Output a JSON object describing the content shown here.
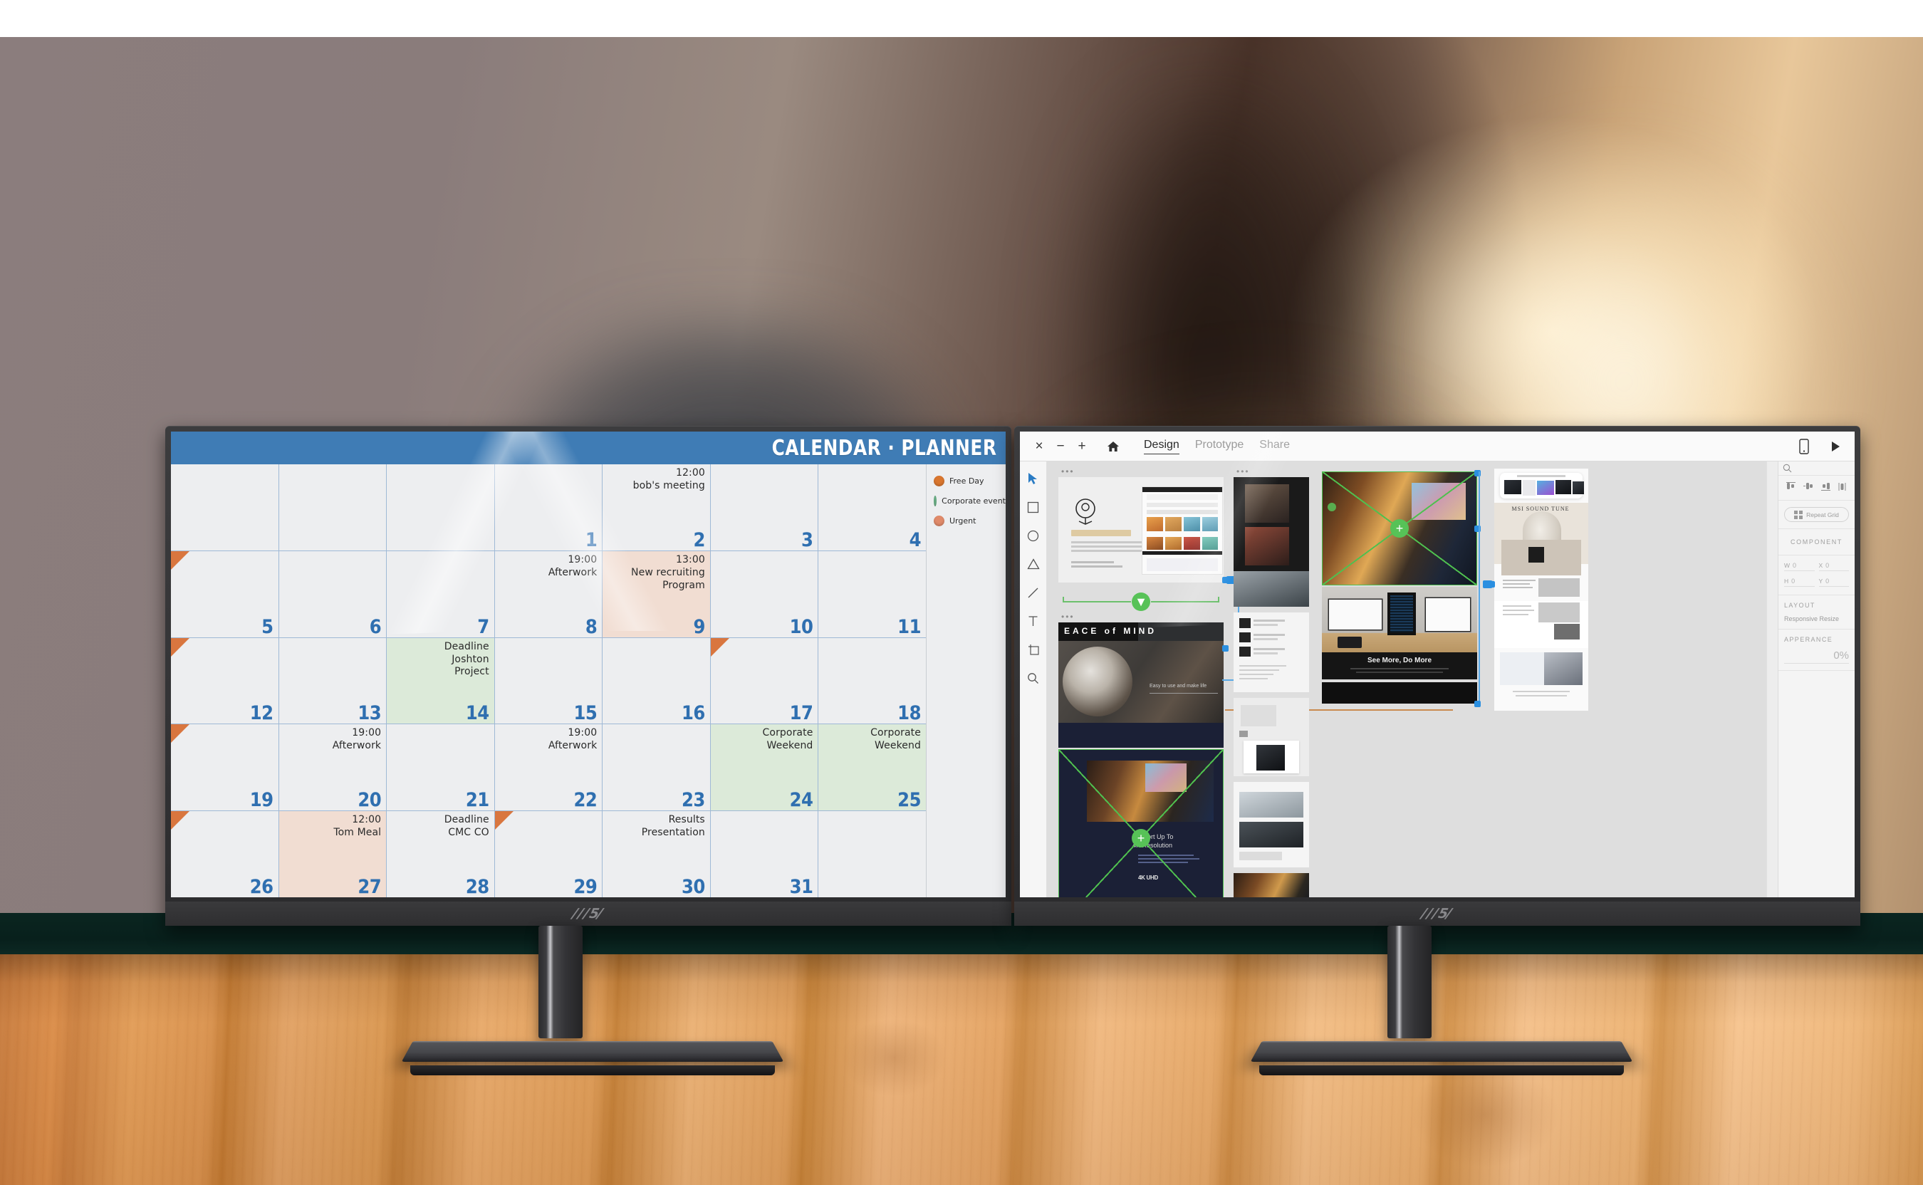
{
  "scene": {
    "description": "Two MSI monitors on a wooden desk",
    "monitor_brand": "MSI",
    "left_monitor_label": "MSI",
    "right_monitor_label": "MSI"
  },
  "calendar": {
    "title": "CALENDAR · PLANNER",
    "header_color": "#3f7cb5",
    "daynum_color": "#2f6fb0",
    "legend": [
      {
        "label": "Free Day",
        "color": "#d9762f"
      },
      {
        "label": "Corporate event",
        "color": "#6cb288"
      },
      {
        "label": "Urgent",
        "color": "#e08a6a"
      }
    ],
    "weeks": [
      [
        {
          "day": "",
          "events": [],
          "fill": "none",
          "corner": false
        },
        {
          "day": "",
          "events": [],
          "fill": "none",
          "corner": false
        },
        {
          "day": "",
          "events": [],
          "fill": "none",
          "corner": false
        },
        {
          "day": "",
          "events": [],
          "fill": "none",
          "corner": false
        },
        {
          "day": "1",
          "events": [],
          "fill": "none",
          "corner": false
        },
        {
          "day": "2",
          "events": [
            "12:00",
            "bob's meeting"
          ],
          "fill": "none",
          "corner": false
        },
        {
          "day": "3",
          "events": [],
          "fill": "none",
          "corner": false
        },
        {
          "day": "4",
          "events": [],
          "fill": "none",
          "corner": false
        }
      ],
      [
        {
          "day": "5",
          "events": [],
          "fill": "none",
          "corner": true
        },
        {
          "day": "6",
          "events": [],
          "fill": "none",
          "corner": false
        },
        {
          "day": "7",
          "events": [],
          "fill": "none",
          "corner": false
        },
        {
          "day": "8",
          "events": [
            "19:00",
            "Afterwork"
          ],
          "fill": "none",
          "corner": false
        },
        {
          "day": "9",
          "events": [
            "13:00",
            "New recruiting",
            "Program"
          ],
          "fill": "salmon",
          "corner": false
        },
        {
          "day": "10",
          "events": [],
          "fill": "none",
          "corner": false
        },
        {
          "day": "11",
          "events": [],
          "fill": "none",
          "corner": false
        }
      ],
      [
        {
          "day": "12",
          "events": [],
          "fill": "none",
          "corner": true
        },
        {
          "day": "13",
          "events": [],
          "fill": "none",
          "corner": false
        },
        {
          "day": "14",
          "events": [
            "Deadline",
            "Joshton",
            "Project"
          ],
          "fill": "green",
          "corner": false
        },
        {
          "day": "15",
          "events": [],
          "fill": "none",
          "corner": false
        },
        {
          "day": "16",
          "events": [],
          "fill": "none",
          "corner": false
        },
        {
          "day": "17",
          "events": [],
          "fill": "none",
          "corner": true
        },
        {
          "day": "18",
          "events": [],
          "fill": "none",
          "corner": false
        }
      ],
      [
        {
          "day": "19",
          "events": [],
          "fill": "none",
          "corner": true
        },
        {
          "day": "20",
          "events": [
            "19:00",
            "Afterwork"
          ],
          "fill": "none",
          "corner": false
        },
        {
          "day": "21",
          "events": [],
          "fill": "none",
          "corner": false
        },
        {
          "day": "22",
          "events": [
            "19:00",
            "Afterwork"
          ],
          "fill": "none",
          "corner": false
        },
        {
          "day": "23",
          "events": [],
          "fill": "none",
          "corner": false
        },
        {
          "day": "24",
          "events": [
            "Corporate",
            "Weekend"
          ],
          "fill": "green",
          "corner": false
        },
        {
          "day": "25",
          "events": [
            "Corporate",
            "Weekend"
          ],
          "fill": "green",
          "corner": false
        }
      ],
      [
        {
          "day": "26",
          "events": [],
          "fill": "none",
          "corner": true
        },
        {
          "day": "27",
          "events": [
            "12:00",
            "Tom Meal"
          ],
          "fill": "salmon",
          "corner": false
        },
        {
          "day": "28",
          "events": [
            "Deadline",
            "CMC CO"
          ],
          "fill": "none",
          "corner": false
        },
        {
          "day": "29",
          "events": [],
          "fill": "none",
          "corner": true
        },
        {
          "day": "30",
          "events": [
            "Results",
            "Presentation"
          ],
          "fill": "none",
          "corner": false
        },
        {
          "day": "31",
          "events": [],
          "fill": "none",
          "corner": false
        },
        {
          "day": "",
          "events": [],
          "fill": "none",
          "corner": false
        }
      ]
    ]
  },
  "xd": {
    "toolbar": {
      "close_label": "×",
      "zoom_out_label": "−",
      "zoom_in_label": "+",
      "home_label": "⌂",
      "tabs": [
        {
          "label": "Design",
          "active": true
        },
        {
          "label": "Prototype",
          "active": false
        },
        {
          "label": "Share",
          "active": false
        }
      ],
      "device_preview_label": "▭",
      "play_label": "▶"
    },
    "tools": [
      "select-arrow",
      "rectangle",
      "ellipse",
      "polygon",
      "line",
      "text",
      "artboard",
      "zoom"
    ],
    "properties": {
      "align_icons": [
        "align-left",
        "align-center-h",
        "align-right",
        "distribute"
      ],
      "repeat_grid_label": "Repeat Grid",
      "component_label": "COMPONENT",
      "fields": [
        {
          "label": "W",
          "value": "0"
        },
        {
          "label": "X",
          "value": "0"
        },
        {
          "label": "H",
          "value": "0"
        },
        {
          "label": "Y",
          "value": "0"
        }
      ],
      "layout_title": "LAYOUT",
      "layout_option": "Responsive Resize",
      "appearance_title": "APPERANCE",
      "opacity_value": "0%"
    },
    "artboards": [
      {
        "id": "ab-1",
        "heading": "",
        "subtext": ""
      },
      {
        "id": "ab-2",
        "heading": "EACE of MIND",
        "subtext": "Easy to use and make life"
      },
      {
        "id": "ab-3",
        "heading": "Support Up To",
        "subheading": "4K Resolution",
        "badge": "4K UHD"
      },
      {
        "id": "ab-4",
        "heading": "See More, Do More",
        "subtext": ""
      },
      {
        "id": "ab-5",
        "heading": "MSI SOUND TUNE",
        "subtext": ""
      }
    ],
    "selection_color": "#4fc04f",
    "link_color": "#2b8fe0"
  }
}
